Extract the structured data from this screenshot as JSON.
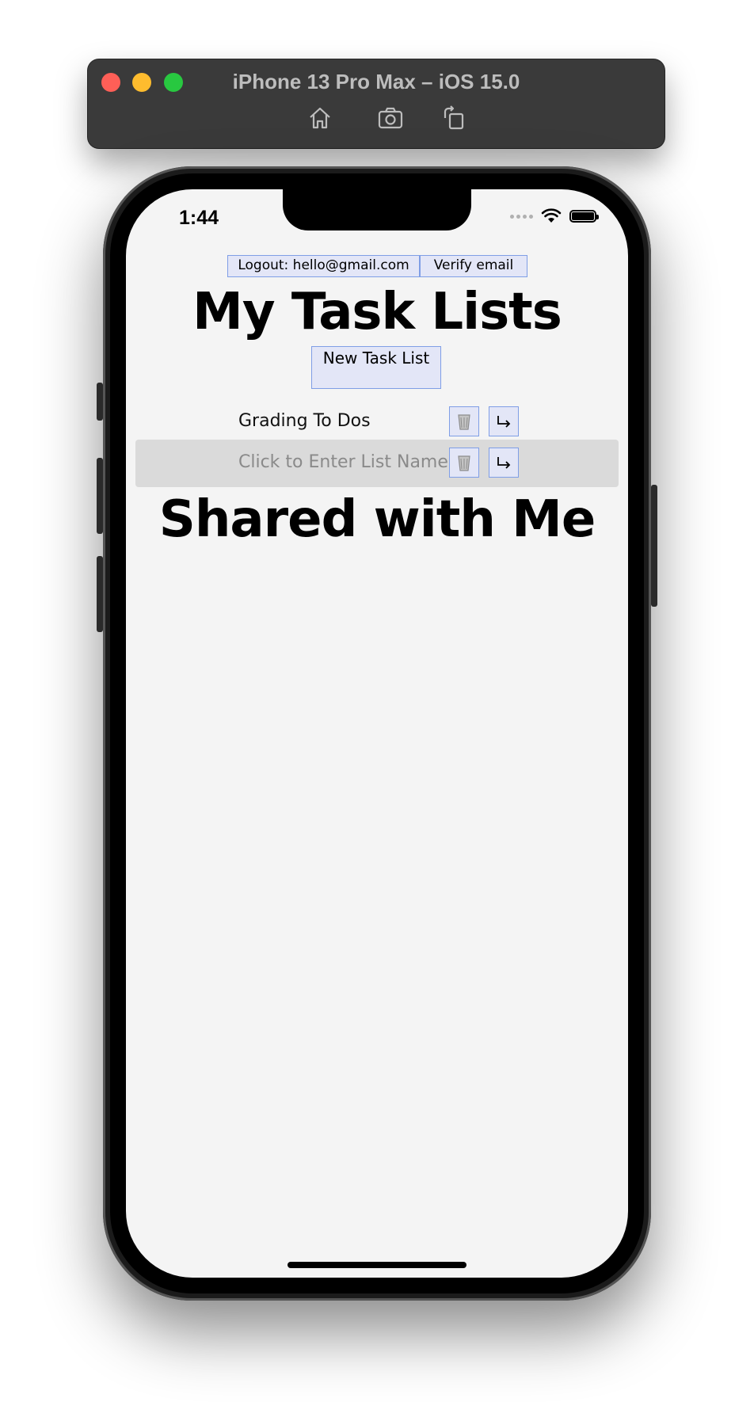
{
  "simulator": {
    "title": "iPhone 13 Pro Max – iOS 15.0",
    "toolbar_icons": [
      "home-icon",
      "screenshot-icon",
      "rotate-icon"
    ]
  },
  "status_bar": {
    "time": "1:44"
  },
  "header": {
    "logout_label": "Logout: hello@gmail.com",
    "verify_label": "Verify email"
  },
  "my_lists": {
    "title": "My Task Lists",
    "new_button_label": "New Task List",
    "items": [
      {
        "name": "Grading To Dos",
        "placeholder": false
      },
      {
        "name": "Click to Enter List Name",
        "placeholder": true
      }
    ]
  },
  "shared": {
    "title": "Shared with Me"
  },
  "colors": {
    "button_bg": "#e3e6f7",
    "button_border": "#7f9ee6",
    "screen_bg": "#f4f4f4",
    "selected_row_bg": "#dadada"
  }
}
